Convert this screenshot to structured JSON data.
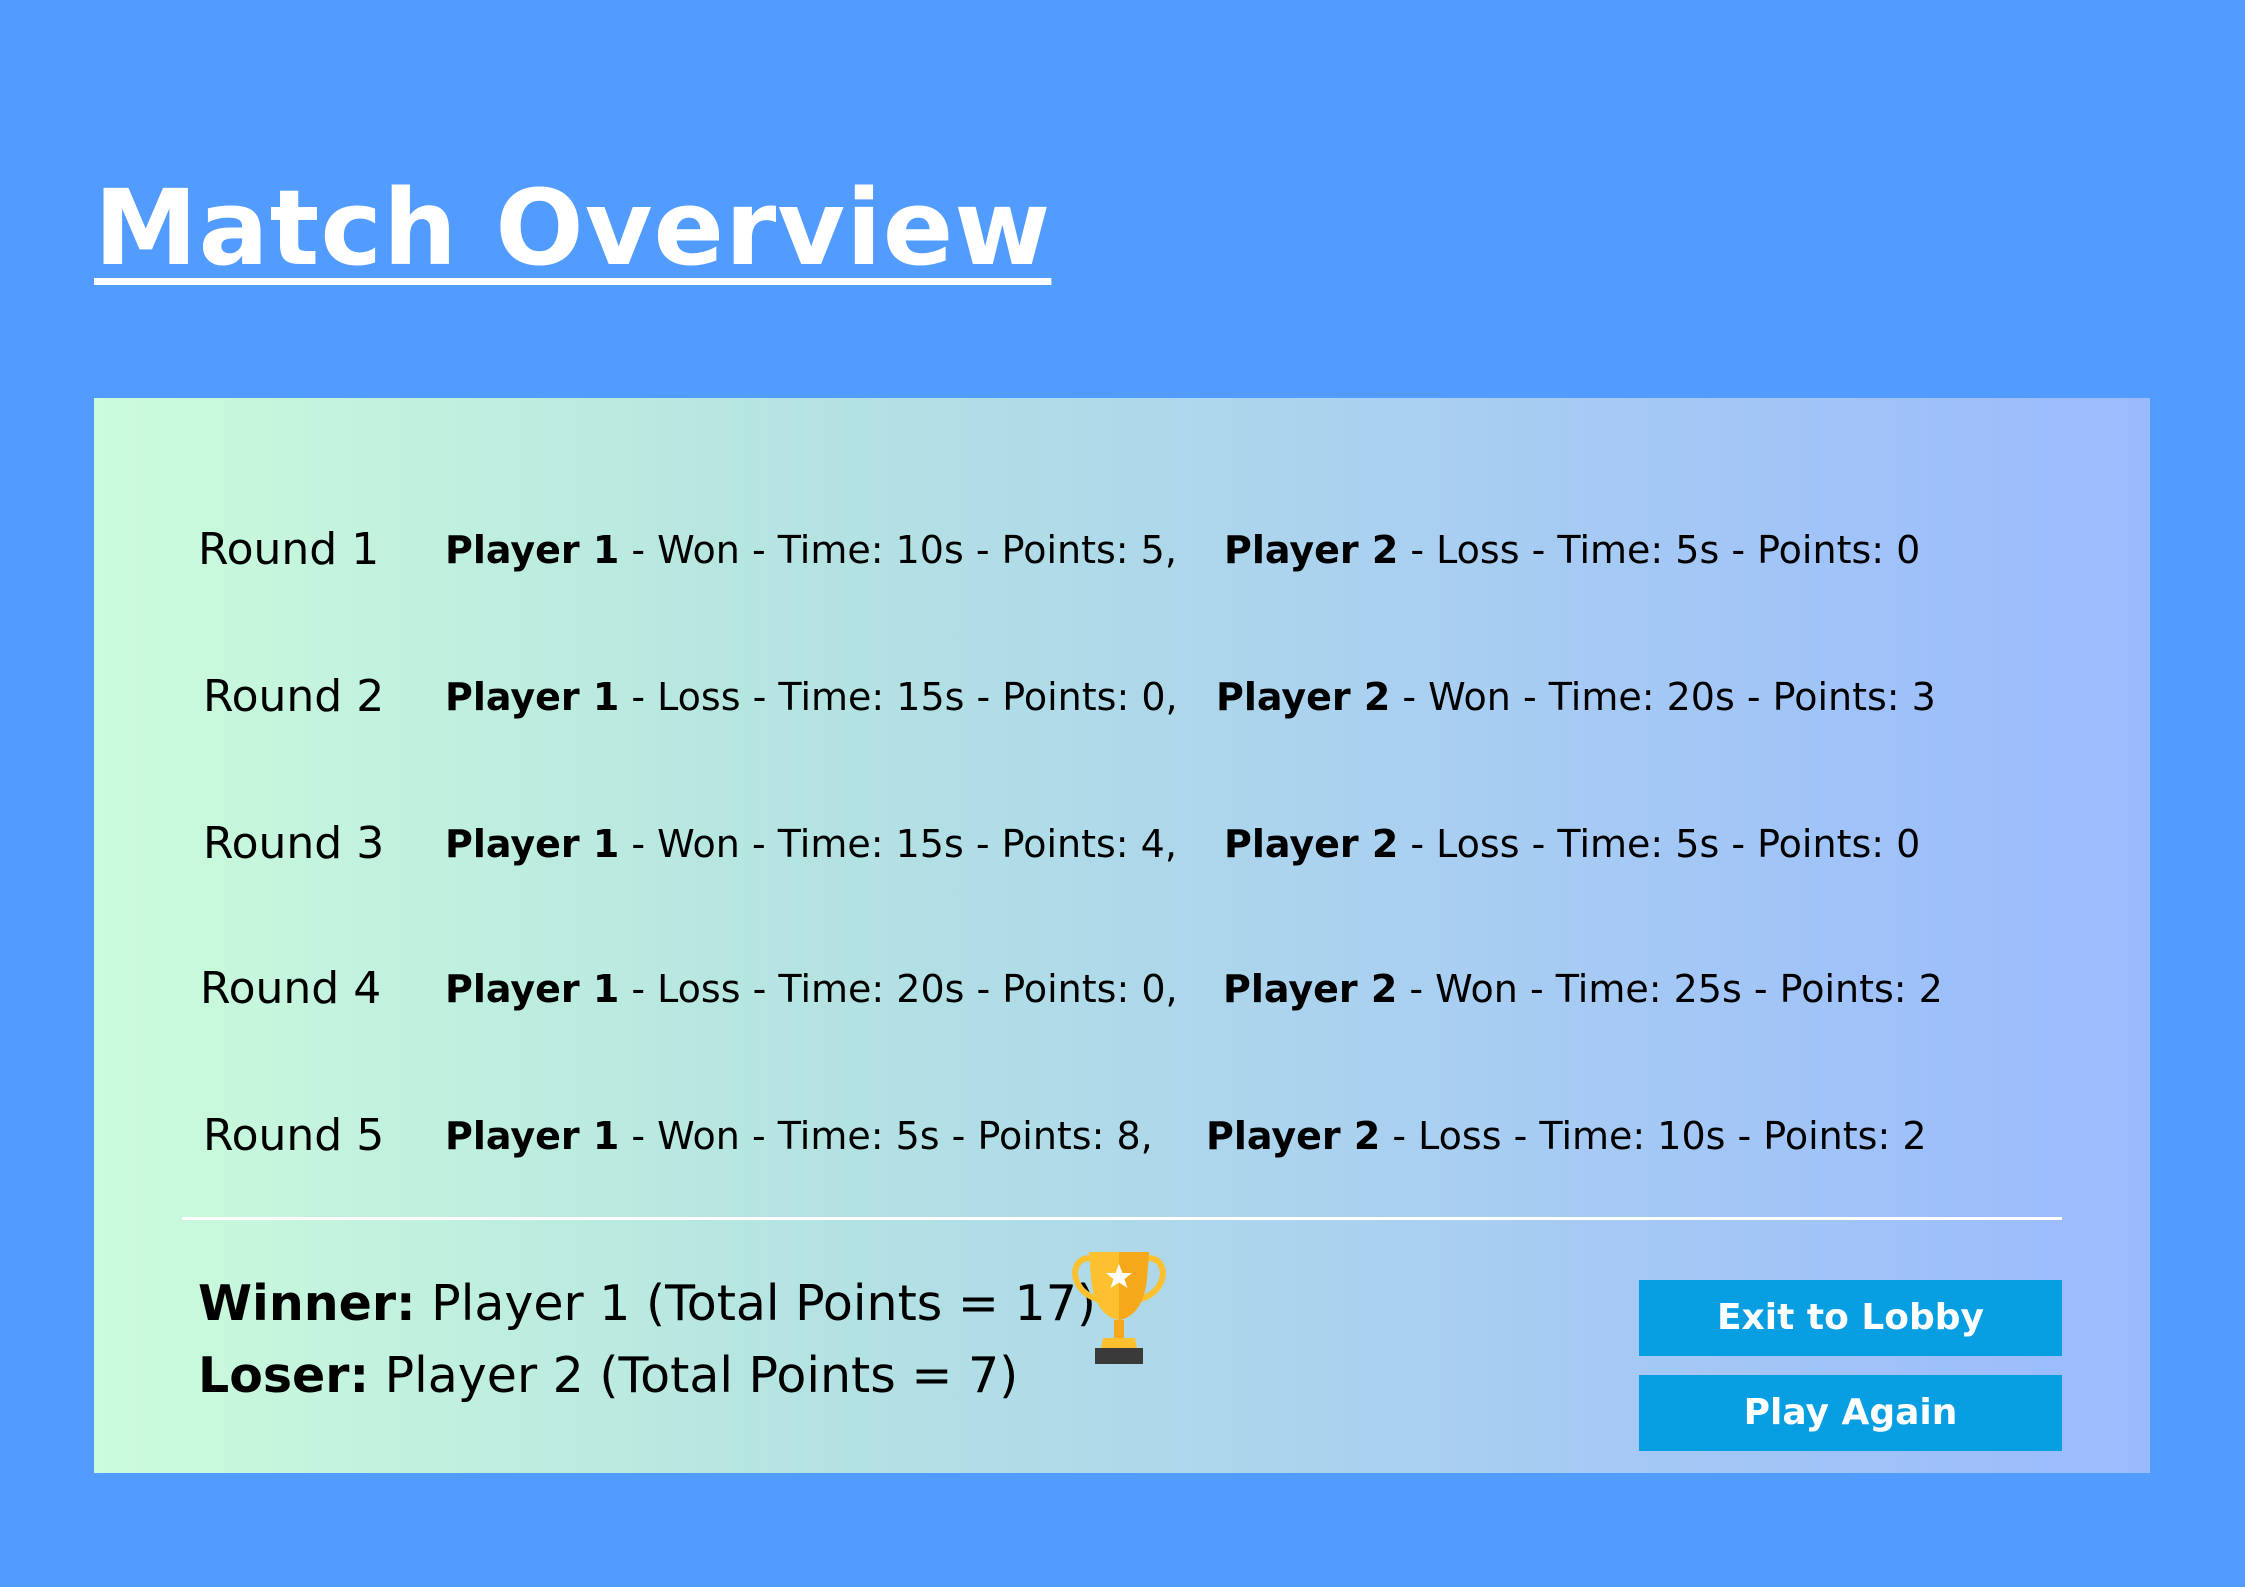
{
  "header": {
    "title": "Match Overview"
  },
  "rounds": [
    {
      "label": "Round 1",
      "player1": {
        "name": "Player 1",
        "detail": " - Won - Time: 10s - Points: 5,"
      },
      "player2": {
        "name": "Player 2",
        "detail": " - Loss - Time: 5s - Points: 0"
      }
    },
    {
      "label": "Round 2",
      "player1": {
        "name": "Player 1",
        "detail": " - Loss - Time: 15s - Points: 0,"
      },
      "player2": {
        "name": "Player 2",
        "detail": " - Won - Time: 20s - Points: 3"
      }
    },
    {
      "label": "Round 3",
      "player1": {
        "name": "Player 1",
        "detail": " - Won - Time: 15s - Points: 4,"
      },
      "player2": {
        "name": "Player 2",
        "detail": " - Loss - Time: 5s - Points: 0"
      }
    },
    {
      "label": "Round 4",
      "player1": {
        "name": "Player 1",
        "detail": " - Loss - Time: 20s - Points: 0,"
      },
      "player2": {
        "name": "Player 2",
        "detail": " - Won - Time: 25s - Points: 2"
      }
    },
    {
      "label": "Round 5",
      "player1": {
        "name": "Player 1",
        "detail": " - Won - Time: 5s - Points: 8,"
      },
      "player2": {
        "name": "Player 2",
        "detail": " - Loss - Time: 10s - Points: 2"
      }
    }
  ],
  "results": {
    "winner_label": "Winner:",
    "winner_text": " Player 1 (Total Points = 17)",
    "loser_label": "Loser:",
    "loser_text": " Player 2 (Total Points = 7)"
  },
  "icons": {
    "trophy": "trophy-icon"
  },
  "buttons": {
    "exit_label": "Exit to Lobby",
    "play_again_label": "Play Again"
  },
  "colors": {
    "background": "#529cff",
    "button": "#079fe2",
    "trophy_gold": "#fdc02f",
    "trophy_base": "#3a3a3a"
  }
}
